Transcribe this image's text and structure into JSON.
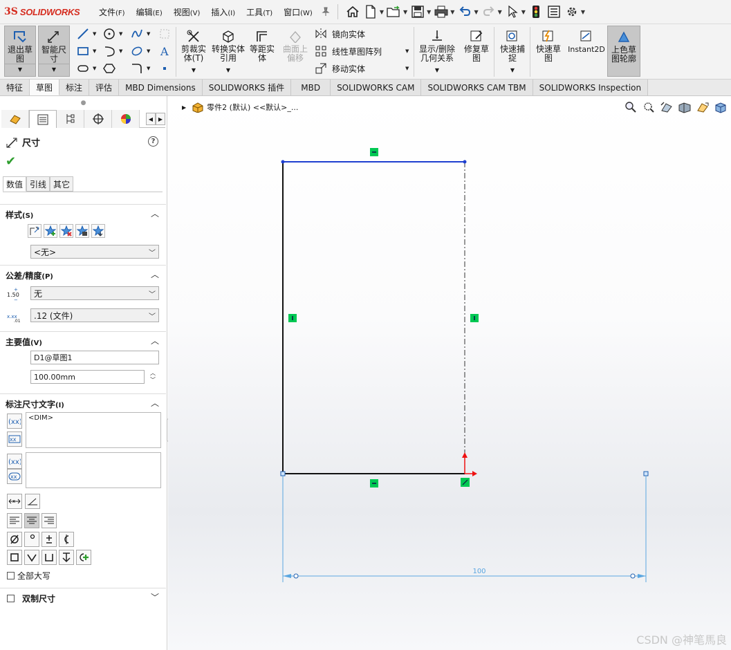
{
  "app": {
    "brand_ds": "3S",
    "brand_name": "SOLIDWORKS"
  },
  "menu": [
    {
      "label": "文件",
      "key": "(F)"
    },
    {
      "label": "编辑",
      "key": "(E)"
    },
    {
      "label": "视图",
      "key": "(V)"
    },
    {
      "label": "插入",
      "key": "(I)"
    },
    {
      "label": "工具",
      "key": "(T)"
    },
    {
      "label": "窗口",
      "key": "(W)"
    }
  ],
  "command_manager": {
    "exit_sketch": "退出草图",
    "smart_dim": "智能尺寸",
    "trim": "剪裁实体(T)",
    "convert": "转换实体引用",
    "offset": "等距实体",
    "surface_offset": "曲面上偏移",
    "mirror": "镜向实体",
    "linear_pattern": "线性草图阵列",
    "move": "移动实体",
    "relations": "显示/删除几何关系",
    "repair": "修复草图",
    "quick_snap": "快速捕捉",
    "rapid_sketch": "快速草图",
    "instant2d": "Instant2D",
    "shaded_contours": "上色草图轮廓"
  },
  "tabs": [
    "特征",
    "草图",
    "标注",
    "评估",
    "MBD Dimensions",
    "SOLIDWORKS 插件",
    "MBD",
    "SOLIDWORKS CAM",
    "SOLIDWORKS CAM TBM",
    "SOLIDWORKS Inspection"
  ],
  "panel": {
    "title": "尺寸",
    "help": "?",
    "subtabs": [
      "数值",
      "引线",
      "其它"
    ],
    "style": {
      "header": "样式",
      "key": "(S)",
      "dropdown": "<无>"
    },
    "tolerance": {
      "header": "公差/精度",
      "key": "(P)",
      "tol_icon_text": "1.50",
      "tol_type": "无",
      "precision": ".12 (文件)"
    },
    "primary": {
      "header": "主要值",
      "key": "(V)",
      "name": "D1@草图1",
      "value": "100.00mm"
    },
    "dimtext": {
      "header": "标注尺寸文字",
      "key": "(I)",
      "text": "<DIM>",
      "all_caps": "全部大写"
    },
    "dual": {
      "header": "双制尺寸"
    }
  },
  "graphics": {
    "tree_label": "零件2 (默认) <<默认>_...",
    "dimension_value": "100",
    "watermark": "CSDN @神笔馬良"
  },
  "colors": {
    "accent_blue": "#1e3fd0",
    "relation_green": "#00c853",
    "dim_blue": "#5aa6e0",
    "brand_red": "#d52b1e"
  }
}
